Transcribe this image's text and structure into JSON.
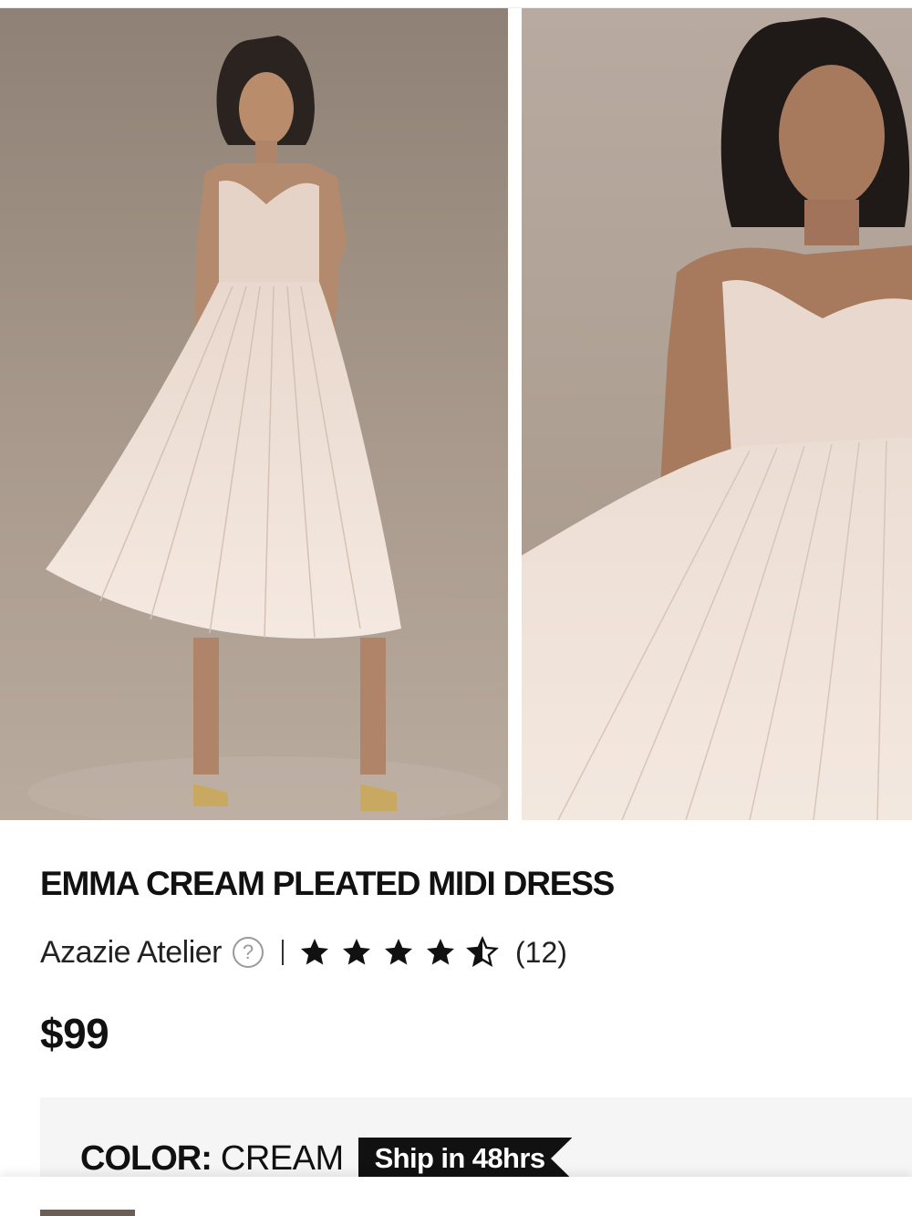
{
  "product": {
    "title": "EMMA CREAM PLEATED MIDI DRESS",
    "brand": "Azazie Atelier",
    "help_icon": "question-circle-icon",
    "rating": 4.5,
    "review_count": "(12)",
    "price": "$99"
  },
  "gallery": {
    "images": [
      {
        "alt": "full-length model photo",
        "icon": "model-photo"
      },
      {
        "alt": "close-up model photo",
        "icon": "model-photo"
      }
    ]
  },
  "color": {
    "label": "COLOR:",
    "value": "CREAM",
    "badge": "Ship in 48hrs"
  },
  "colors": {
    "star": "#111111",
    "panel": "#f5f5f5",
    "badge_bg": "#111111",
    "dress": "#ead9cf"
  }
}
